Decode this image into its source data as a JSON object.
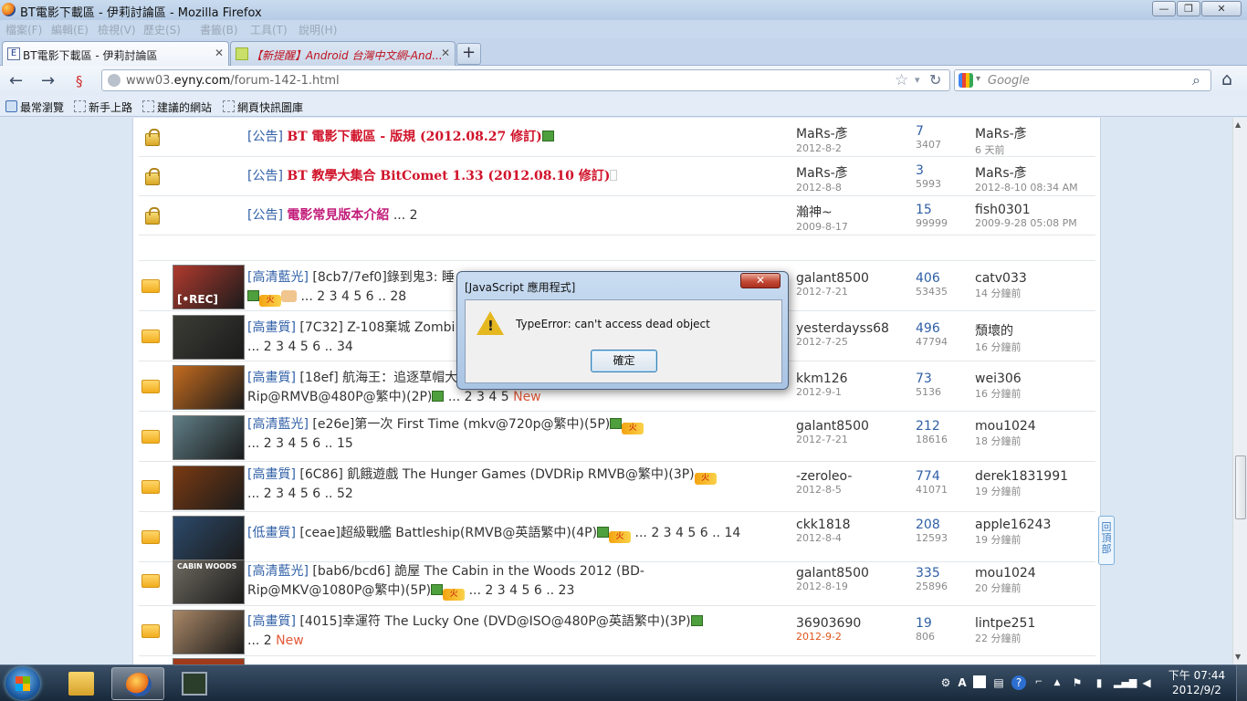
{
  "window": {
    "title": "BT電影下載區 - 伊莉討論區 - Mozilla Firefox",
    "minimize": "—",
    "maximize": "❐",
    "close": "✕"
  },
  "menu": [
    "檔案(F)",
    "編輯(E)",
    "檢視(V)",
    "歷史(S)",
    "書籤(B)",
    "工具(T)",
    "說明(H)"
  ],
  "tabs": [
    {
      "label": "BT電影下載區 - 伊莉討論區",
      "icon": "E"
    },
    {
      "label": "【新提醒】Android 台灣中文網-And...",
      "icon": ""
    }
  ],
  "nav": {
    "back": "←",
    "forward": "→",
    "url_prefix": "www03.",
    "url_domain": "eyny.com",
    "url_path": "/forum-142-1.html",
    "search_placeholder": "Google"
  },
  "bookmarks": [
    "最常瀏覽",
    "新手上路",
    "建議的網站",
    "網頁快訊圖庫"
  ],
  "announcements": [
    {
      "cat": "[公告]",
      "title": "BT 電影下載區 - 版規 (2012.08.27 修訂)",
      "pink": false,
      "pages": "",
      "author": "MaRs-彥",
      "adate": "2012-8-2",
      "replies": "7",
      "views": "3407",
      "last_user": "MaRs-彥",
      "last_time": "6 天前"
    },
    {
      "cat": "[公告]",
      "title": "BT 教學大集合 BitComet 1.33 (2012.08.10 修訂)",
      "pink": false,
      "pages": "",
      "author": "MaRs-彥",
      "adate": "2012-8-8",
      "replies": "3",
      "views": "5993",
      "last_user": "MaRs-彥",
      "last_time": "2012-8-10 08:34 AM"
    },
    {
      "cat": "[公告]",
      "title": "電影常見版本介紹",
      "pink": true,
      "pages": "... 2",
      "author": "瀚神~",
      "adate": "2009-8-17",
      "replies": "15",
      "views": "99999",
      "last_user": "fish0301",
      "last_time": "2009-9-28 05:08 PM"
    }
  ],
  "threads": [
    {
      "cat": "[高清藍光]",
      "title": "[8cb7/7ef0]錄到鬼3: 睡",
      "pages": "... 2 3 4 5 6 .. 28",
      "new": "",
      "thumb_label": "[•REC]",
      "thumb_color": "#b03a2e",
      "author": "galant8500",
      "adate": "2012-7-21",
      "today": false,
      "replies": "406",
      "views": "53435",
      "last_user": "catv033",
      "last_time": "14 分鐘前"
    },
    {
      "cat": "[高畫質]",
      "title": "[7C32] Z-108棄城 Zombi",
      "pages": "... 2 3 4 5 6 .. 34",
      "new": "",
      "thumb_label": "",
      "thumb_color": "#3c3c36",
      "author": "yesterdayss68",
      "adate": "2012-7-25",
      "today": false,
      "replies": "496",
      "views": "47794",
      "last_user": "頹壞的",
      "last_time": "16 分鐘前"
    },
    {
      "cat": "[高畫質]",
      "title": "[18ef] 航海王：追逐草帽大",
      "line2": "Rip@RMVB@480P@繁中)(2P)",
      "pages": "... 2 3 4 5",
      "new": "New",
      "thumb_label": "",
      "thumb_color": "#c46b1e",
      "author": "kkm126",
      "adate": "2012-9-1",
      "today": false,
      "replies": "73",
      "views": "5136",
      "last_user": "wei306",
      "last_time": "16 分鐘前"
    },
    {
      "cat": "[高清藍光]",
      "title": "[e26e]第一次 First Time (mkv@720p@繁中)(5P)",
      "pages": "... 2 3 4 5 6 .. 15",
      "new": "",
      "thumb_label": "",
      "thumb_color": "#5f7e86",
      "author": "galant8500",
      "adate": "2012-7-21",
      "today": false,
      "replies": "212",
      "views": "18616",
      "last_user": "mou1024",
      "last_time": "18 分鐘前"
    },
    {
      "cat": "[高畫質]",
      "title": "[6C86] 飢餓遊戲 The Hunger Games (DVDRip RMVB@繁中)(3P)",
      "pages": "... 2 3 4 5 6 .. 52",
      "new": "",
      "thumb_label": "",
      "thumb_color": "#7a3a12",
      "author": "-zeroleo-",
      "adate": "2012-8-5",
      "today": false,
      "replies": "774",
      "views": "41071",
      "last_user": "derek1831991",
      "last_time": "19 分鐘前"
    },
    {
      "cat": "[低畫質]",
      "title": "[ceae]超級戰艦 Battleship(RMVB@英語繁中)(4P)",
      "pages": "... 2 3 4 5 6 .. 14",
      "new": "",
      "thumb_label": "",
      "thumb_color": "#2c4a6b",
      "author": "ckk1818",
      "adate": "2012-8-4",
      "today": false,
      "replies": "208",
      "views": "12593",
      "last_user": "apple16243",
      "last_time": "19 分鐘前"
    },
    {
      "cat": "[高清藍光]",
      "title": "[bab6/bcd6] 詭屋 The Cabin in the Woods 2012 (BD-",
      "line2": "Rip@MKV@1080P@繁中)(5P)",
      "pages": "... 2 3 4 5 6 .. 23",
      "new": "",
      "thumb_label": "CABIN WOODS",
      "thumb_color": "#6e6a60",
      "author": "galant8500",
      "adate": "2012-8-19",
      "today": false,
      "replies": "335",
      "views": "25896",
      "last_user": "mou1024",
      "last_time": "20 分鐘前"
    },
    {
      "cat": "[高畫質]",
      "title": "[4015]幸運符 The Lucky One (DVD@ISO@480P@英語繁中)(3P)",
      "pages": "... 2",
      "new": "New",
      "thumb_label": "",
      "thumb_color": "#a98766",
      "author": "36903690",
      "adate": "2012-9-2",
      "today": true,
      "replies": "19",
      "views": "806",
      "last_user": "lintpe251",
      "last_time": "22 分鐘前"
    }
  ],
  "back_to_top": "回頂部",
  "dialog": {
    "title": "[JavaScript 應用程式]",
    "message": "TypeError: can't access dead object",
    "ok": "確定",
    "close": "✕"
  },
  "taskbar": {
    "time": "下午 07:44",
    "date": "2012/9/2"
  }
}
